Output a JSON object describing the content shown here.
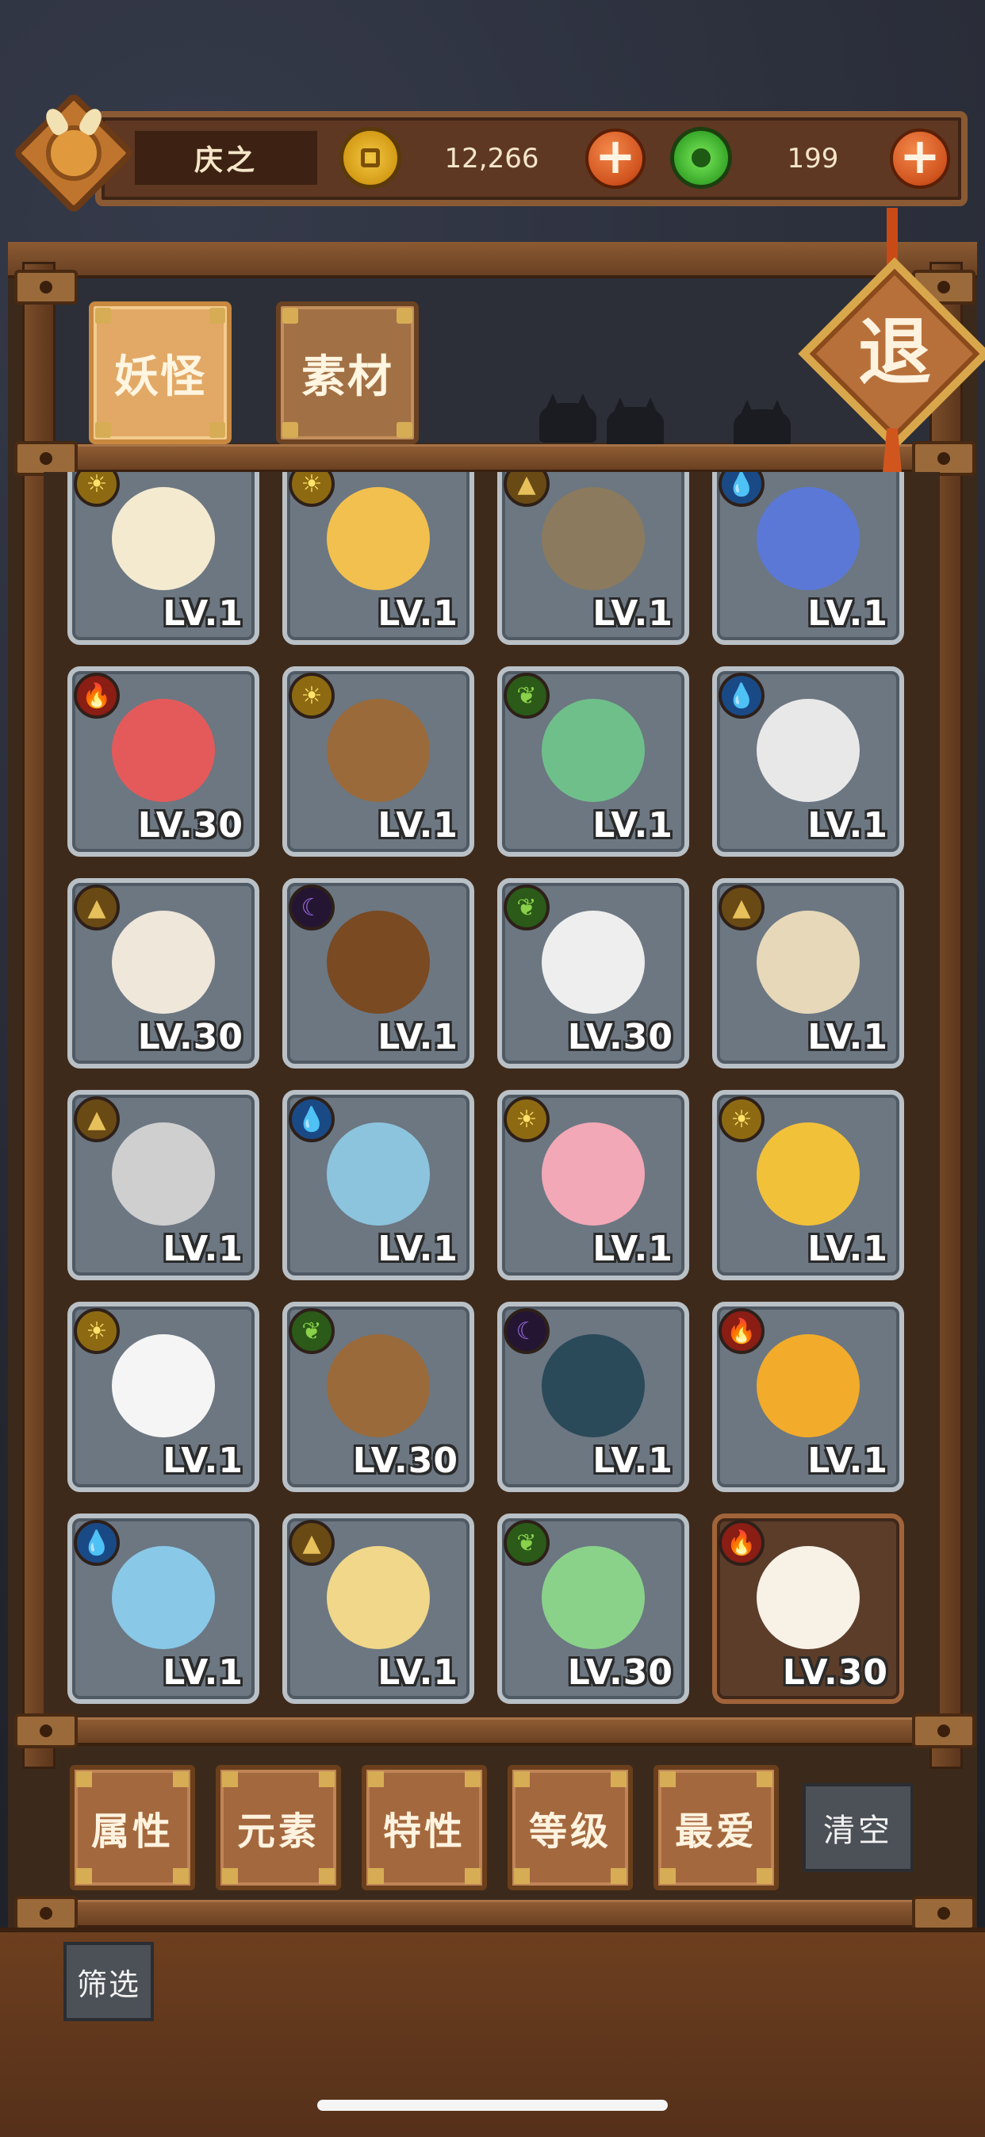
{
  "header": {
    "player_name": "庆之",
    "coins": "12,266",
    "gems": "199",
    "plus_label": "+"
  },
  "tabs": [
    {
      "label": "妖怪",
      "active": true
    },
    {
      "label": "素材",
      "active": false
    }
  ],
  "exit_label": "退",
  "monsters": [
    {
      "element": "sun",
      "level": "LV.1",
      "art": "ice-cream"
    },
    {
      "element": "sun",
      "level": "LV.1",
      "art": "tofu-block"
    },
    {
      "element": "earth",
      "level": "LV.1",
      "art": "cat"
    },
    {
      "element": "water",
      "level": "LV.1",
      "art": "blue-flower"
    },
    {
      "element": "fire",
      "level": "LV.30",
      "art": "red-flower"
    },
    {
      "element": "sun",
      "level": "LV.1",
      "art": "wooden-stocks"
    },
    {
      "element": "leaf",
      "level": "LV.1",
      "art": "green-jar"
    },
    {
      "element": "water",
      "level": "LV.1",
      "art": "ink-brush"
    },
    {
      "element": "earth",
      "level": "LV.30",
      "art": "bamboo-ghost"
    },
    {
      "element": "dark",
      "level": "LV.1",
      "art": "wooden-chest"
    },
    {
      "element": "leaf",
      "level": "LV.30",
      "art": "paper-horse-cart"
    },
    {
      "element": "earth",
      "level": "LV.1",
      "art": "straw-hat-warrior"
    },
    {
      "element": "earth",
      "level": "LV.1",
      "art": "trident-lamp"
    },
    {
      "element": "water",
      "level": "LV.1",
      "art": "blue-fish"
    },
    {
      "element": "sun",
      "level": "LV.1",
      "art": "peach"
    },
    {
      "element": "sun",
      "level": "LV.1",
      "art": "gold-ingot"
    },
    {
      "element": "sun",
      "level": "LV.1",
      "art": "white-duck"
    },
    {
      "element": "leaf",
      "level": "LV.30",
      "art": "root-sprout"
    },
    {
      "element": "dark",
      "level": "LV.1",
      "art": "one-eye-ghost"
    },
    {
      "element": "fire",
      "level": "LV.1",
      "art": "yellow-chick"
    },
    {
      "element": "water",
      "level": "LV.1",
      "art": "ice-spirit"
    },
    {
      "element": "earth",
      "level": "LV.1",
      "art": "crystal-stone"
    },
    {
      "element": "leaf",
      "level": "LV.30",
      "art": "jade-spirit"
    },
    {
      "element": "fire",
      "level": "LV.30",
      "art": "fire-horse",
      "highlighted": true
    }
  ],
  "filters": [
    "属性",
    "元素",
    "特性",
    "等级",
    "最爱"
  ],
  "clear_label": "清空",
  "screen_label": "筛选",
  "colors": {
    "card_bg": "#6c7782",
    "wood": "#a4683e",
    "active_tab": "#e2a865"
  }
}
